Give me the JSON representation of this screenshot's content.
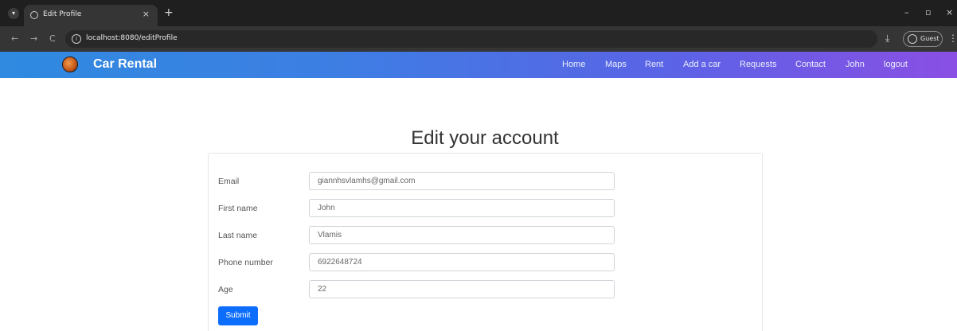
{
  "browser": {
    "tab_title": "Edit Profile",
    "tab_close": "×",
    "new_tab": "+",
    "url": "localhost:8080/editProfile",
    "profile_label": "Guest",
    "window_controls": {
      "minimize": "–",
      "restore": "▫",
      "close": "×"
    },
    "nav": {
      "back": "←",
      "forward": "→",
      "reload": "C"
    }
  },
  "site": {
    "brand": "Car Rental",
    "nav": [
      "Home",
      "Maps",
      "Rent",
      "Add a car",
      "Requests",
      "Contact",
      "John",
      "logout"
    ]
  },
  "form": {
    "title": "Edit your account",
    "fields": [
      {
        "label": "Email",
        "value": "giannhsvlamhs@gmail.com"
      },
      {
        "label": "First name",
        "value": "John"
      },
      {
        "label": "Last name",
        "value": "Vlamis"
      },
      {
        "label": "Phone number",
        "value": "6922648724"
      },
      {
        "label": "Age",
        "value": "22"
      }
    ],
    "submit_label": "Submit"
  },
  "colors": {
    "navbar_start": "#2f8ae0",
    "navbar_end": "#8a4fe4",
    "primary_button": "#0d6efd"
  },
  "icons": [
    "menu-icon",
    "globe-icon",
    "close-icon",
    "plus-icon",
    "back-icon",
    "forward-icon",
    "reload-icon",
    "info-icon",
    "download-icon",
    "avatar-icon",
    "kebab-icon",
    "car-logo-icon"
  ]
}
